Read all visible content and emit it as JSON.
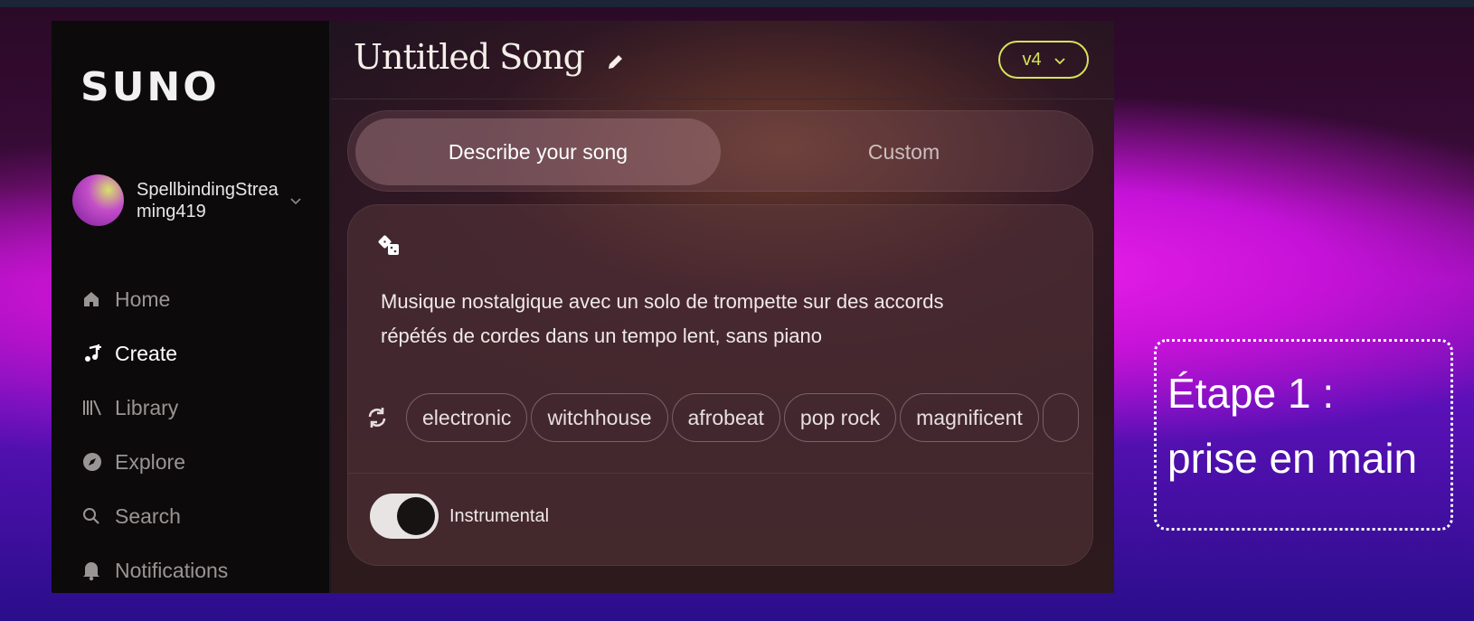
{
  "brand": {
    "logo": "SUNO"
  },
  "user": {
    "name": "SpellbindingStreaming419"
  },
  "nav": [
    {
      "label": "Home",
      "icon": "home-icon"
    },
    {
      "label": "Create",
      "icon": "create-music-icon",
      "active": true
    },
    {
      "label": "Library",
      "icon": "library-icon"
    },
    {
      "label": "Explore",
      "icon": "compass-icon"
    },
    {
      "label": "Search",
      "icon": "search-icon"
    },
    {
      "label": "Notifications",
      "icon": "bell-icon"
    }
  ],
  "header": {
    "title": "Untitled Song",
    "version": "v4"
  },
  "mode_tabs": {
    "describe": "Describe your song",
    "custom": "Custom"
  },
  "prompt": {
    "line1": "Musique nostalgique avec un solo de trompette sur des accords",
    "line2": "répétés de cordes dans un tempo lent, sans piano"
  },
  "tags": [
    "electronic",
    "witchhouse",
    "afrobeat",
    "pop rock",
    "magnificent"
  ],
  "instrumental": {
    "label": "Instrumental",
    "on": true
  },
  "callout": {
    "line1": "Étape 1 :",
    "line2": "prise en main"
  },
  "colors": {
    "accent": "#d6e25a",
    "sidebar": "#0c0a0a",
    "background_magenta": "#e81ee8"
  }
}
